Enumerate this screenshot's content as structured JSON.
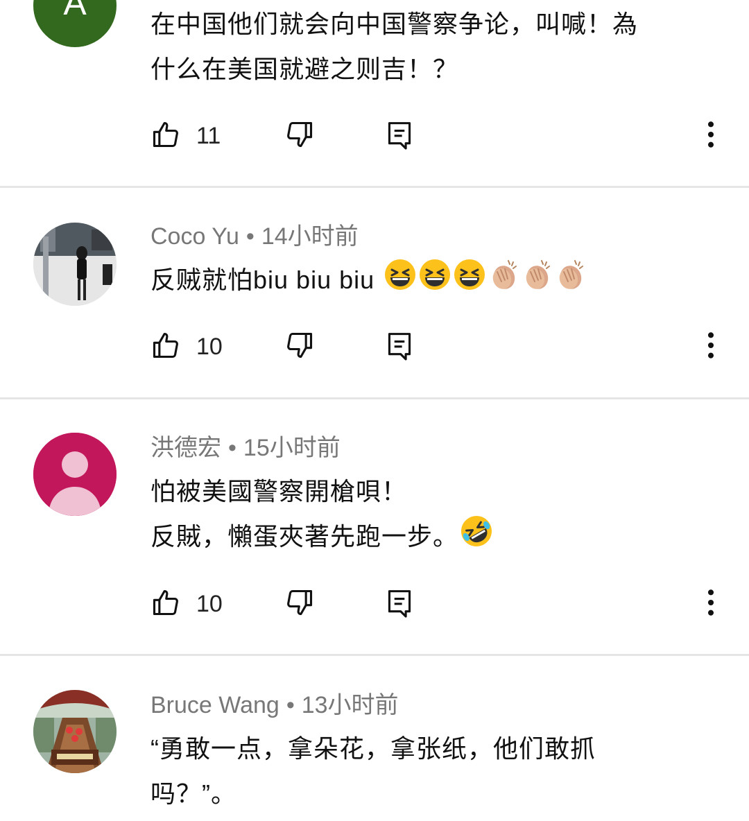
{
  "comments": [
    {
      "avatar_letter": "A",
      "avatar_color": "#33691e",
      "lines": [
        "在中国他们就会向中国警察争论，叫喊！為",
        "什么在美国就避之则吉！？"
      ],
      "likes": "11"
    },
    {
      "author": "Coco Yu",
      "time": "14小时前",
      "lines": [
        "反贼就怕biu biu biu"
      ],
      "emojis": [
        "laughing-emoji",
        "laughing-emoji",
        "laughing-emoji",
        "clapping-hands-emoji",
        "clapping-hands-emoji",
        "clapping-hands-emoji"
      ],
      "likes": "10"
    },
    {
      "author": "洪德宏",
      "time": "15小时前",
      "avatar_color": "#c2185b",
      "lines": [
        "怕被美國警察開槍唄！",
        "反賊，懶蛋夾著先跑一步。"
      ],
      "emojis": [
        "rolling-laughing-emoji"
      ],
      "likes": "10"
    },
    {
      "author": "Bruce Wang",
      "time": "13小时前",
      "lines": [
        "“勇敢一点，拿朵花，拿张纸，他们敢抓",
        "吗？”。"
      ]
    }
  ],
  "separator": "•",
  "colors": {
    "meta_text": "#777777",
    "body_text": "#111111",
    "divider": "#e5e5e5"
  }
}
